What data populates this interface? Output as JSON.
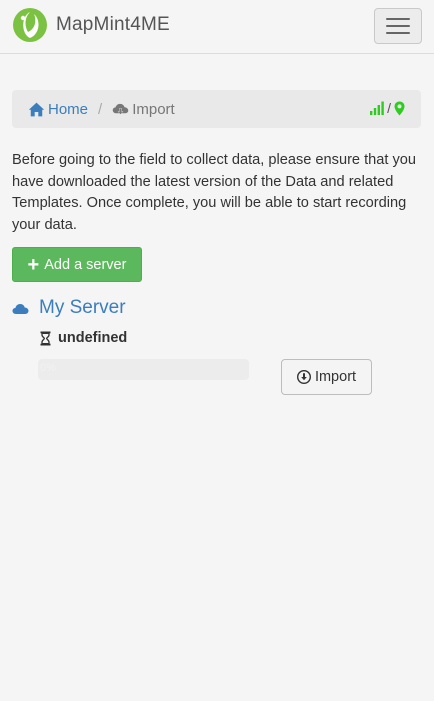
{
  "app": {
    "name": "MapMint4ME",
    "logo_icon": "mapmint-leaf-logo",
    "menu_icon": "hamburger-menu-icon"
  },
  "breadcrumb": {
    "home_label": "Home",
    "separator": "/",
    "current_label": "Import",
    "status_separator": "/",
    "signal_icon": "signal-bars-icon",
    "location_icon": "map-marker-icon"
  },
  "intro_text": "Before going to the field to collect data, please ensure that you have downloaded the latest version of the Data and related Templates. Once complete, you will be able to start recording your data.",
  "actions": {
    "add_server_label": "Add a server"
  },
  "servers": [
    {
      "name": "My Server",
      "status": "undefined",
      "progress_text": "0%",
      "progress_value": 0,
      "import_label": "Import"
    }
  ],
  "colors": {
    "accent_blue": "#3b7dbd",
    "success_green": "#5cb85c",
    "status_green": "#2ecc1f",
    "logo_green": "#7cc242"
  }
}
